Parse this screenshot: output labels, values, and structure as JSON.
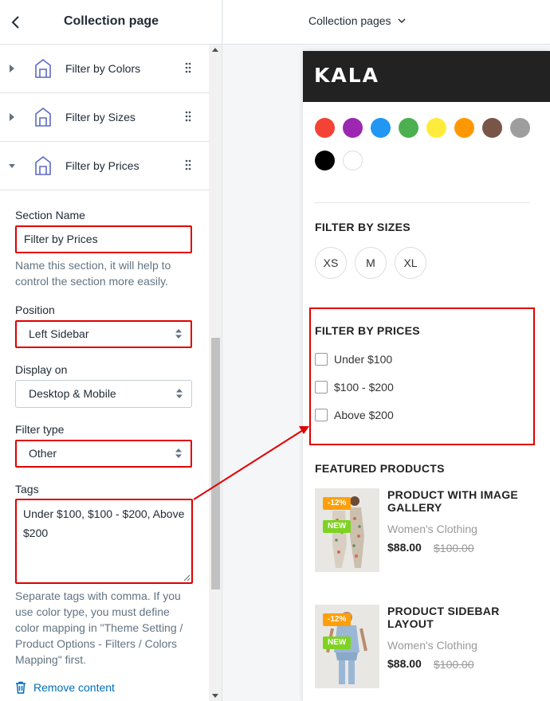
{
  "editor": {
    "title": "Collection page",
    "sections": [
      {
        "label": "Filter by Colors"
      },
      {
        "label": "Filter by Sizes"
      },
      {
        "label": "Filter by Prices"
      }
    ],
    "form": {
      "section_name_label": "Section Name",
      "section_name_value": "Filter by Prices",
      "section_name_help": "Name this section, it will help to control the section more easily.",
      "position_label": "Position",
      "position_value": "Left Sidebar",
      "display_label": "Display on",
      "display_value": "Desktop & Mobile",
      "filter_type_label": "Filter type",
      "filter_type_value": "Other",
      "tags_label": "Tags",
      "tags_value": "Under $100, $100 - $200, Above $200",
      "tags_help": "Separate tags with comma. If you use color type, you must define color mapping in \"Theme Setting / Product Options - Filters / Colors Mapping\" first."
    },
    "remove_label": "Remove content"
  },
  "preview": {
    "page_selector": "Collection pages",
    "logo": "KALA",
    "colors": [
      "#f44336",
      "#9c27b0",
      "#2196f3",
      "#4caf50",
      "#ffeb3b",
      "#ff9800",
      "#795548",
      "#9e9e9e",
      "#000000",
      "#ffffff"
    ],
    "sizes_heading": "FILTER BY SIZES",
    "sizes": [
      "XS",
      "M",
      "XL"
    ],
    "prices_heading": "FILTER BY PRICES",
    "prices": [
      "Under $100",
      "$100 - $200",
      "Above $200"
    ],
    "featured_heading": "FEATURED PRODUCTS",
    "products": [
      {
        "title": "PRODUCT WITH IMAGE GALLERY",
        "category": "Women's Clothing",
        "price": "$88.00",
        "old_price": "$100.00",
        "sale_badge": "-12%",
        "new_badge": "NEW"
      },
      {
        "title": "PRODUCT SIDEBAR LAYOUT",
        "category": "Women's Clothing",
        "price": "$88.00",
        "old_price": "$100.00",
        "sale_badge": "-12%",
        "new_badge": "NEW"
      }
    ]
  },
  "colors": {
    "highlight": "#e00000",
    "link": "#006fbb",
    "header_bg": "#222222"
  }
}
